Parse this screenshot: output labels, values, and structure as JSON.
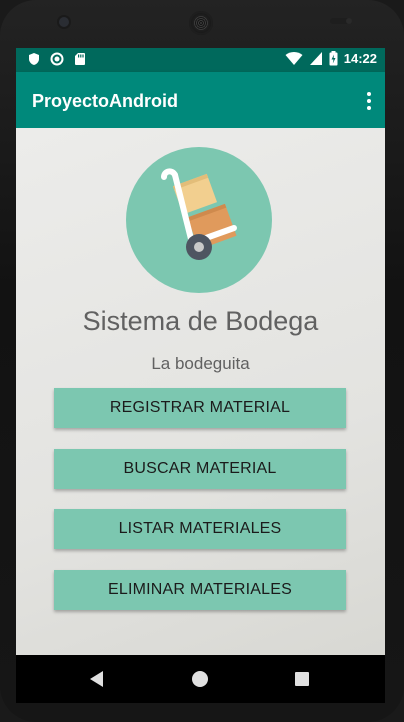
{
  "status_bar": {
    "time": "14:22",
    "left_icons": [
      "shield-icon",
      "circle-icon",
      "sd-card-icon"
    ],
    "right_icons": [
      "wifi-icon",
      "signal-icon",
      "battery-icon"
    ]
  },
  "app_bar": {
    "title": "ProyectoAndroid",
    "menu_icon": "overflow-menu-icon"
  },
  "main": {
    "logo_icon": "hand-truck-boxes-icon",
    "title": "Sistema de Bodega",
    "subtitle": "La bodeguita",
    "buttons": [
      {
        "label": "REGISTRAR MATERIAL"
      },
      {
        "label": "BUSCAR MATERIAL"
      },
      {
        "label": "LISTAR MATERIALES"
      },
      {
        "label": "ELIMINAR MATERIALES"
      }
    ]
  },
  "nav_bar": {
    "icons": [
      "back-icon",
      "home-icon",
      "recents-icon"
    ]
  },
  "colors": {
    "status_bar": "#00695c",
    "app_bar": "#00897b",
    "accent": "#7cc7b0"
  }
}
